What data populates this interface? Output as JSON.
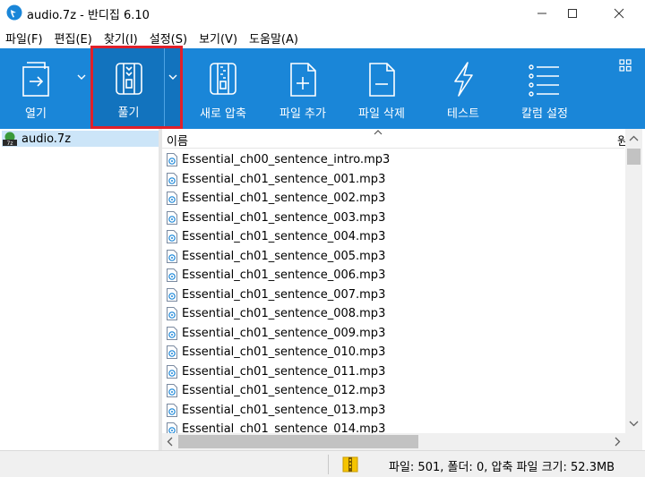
{
  "window": {
    "title": "audio.7z - 반디집 6.10"
  },
  "menu": [
    "파일(F)",
    "편집(E)",
    "찾기(I)",
    "설정(S)",
    "보기(V)",
    "도움말(A)"
  ],
  "toolbar": {
    "open": "열기",
    "extract": "풀기",
    "new_archive": "새로 압축",
    "add_file": "파일 추가",
    "delete_file": "파일 삭제",
    "test": "테스트",
    "column_settings": "칼럼 설정"
  },
  "tree": {
    "archive": "audio.7z"
  },
  "list": {
    "col_name": "이름",
    "col_next": "원",
    "files": [
      "Essential_ch00_sentence_intro.mp3",
      "Essential_ch01_sentence_001.mp3",
      "Essential_ch01_sentence_002.mp3",
      "Essential_ch01_sentence_003.mp3",
      "Essential_ch01_sentence_004.mp3",
      "Essential_ch01_sentence_005.mp3",
      "Essential_ch01_sentence_006.mp3",
      "Essential_ch01_sentence_007.mp3",
      "Essential_ch01_sentence_008.mp3",
      "Essential_ch01_sentence_009.mp3",
      "Essential_ch01_sentence_010.mp3",
      "Essential_ch01_sentence_011.mp3",
      "Essential_ch01_sentence_012.mp3",
      "Essential_ch01_sentence_013.mp3",
      "Essential_ch01_sentence_014.mp3"
    ]
  },
  "status": {
    "text": "파일: 501, 폴더: 0, 압축 파일 크기: 52.3MB"
  },
  "colors": {
    "toolbar": "#1a86d8",
    "highlight": "#e0202a",
    "selection": "#cce5f8"
  }
}
